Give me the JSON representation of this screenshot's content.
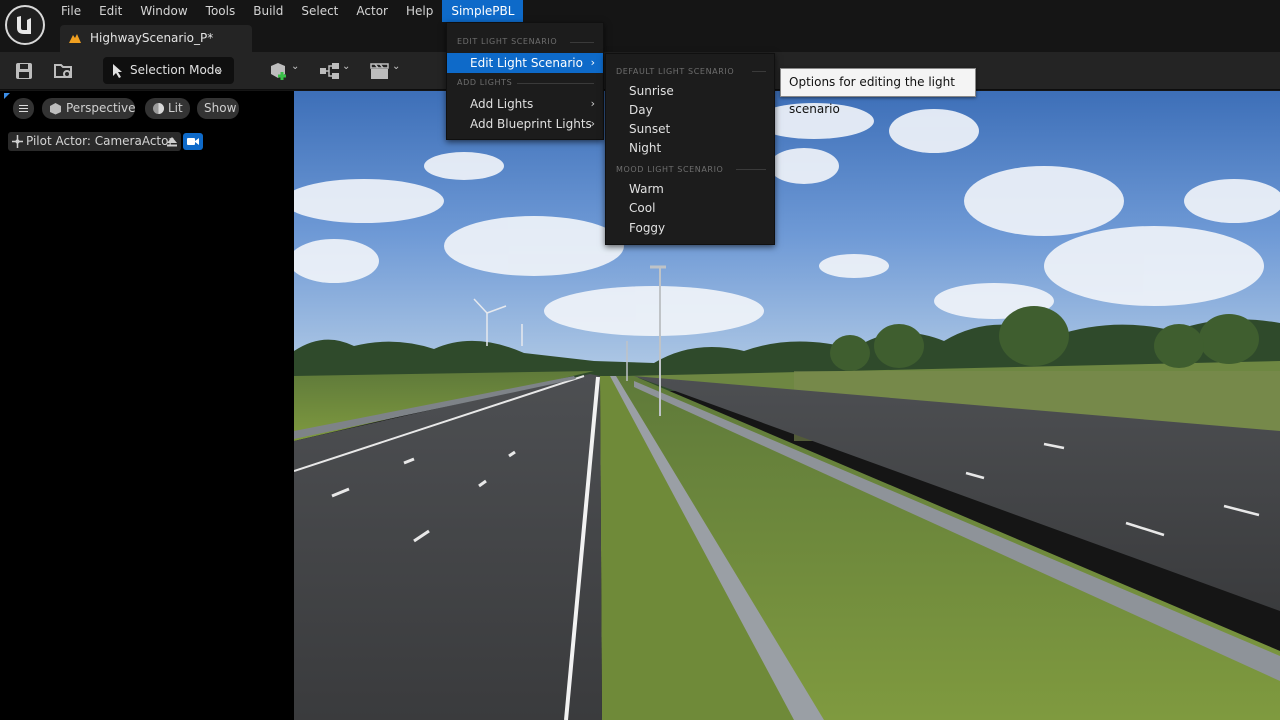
{
  "menubar": {
    "items": [
      "File",
      "Edit",
      "Window",
      "Tools",
      "Build",
      "Select",
      "Actor",
      "Help",
      "SimplePBL"
    ],
    "active_index": 8
  },
  "tab": {
    "title": "HighwayScenario_P*"
  },
  "toolbar": {
    "mode_label": "Selection Mode",
    "icons": [
      "save-icon",
      "content-browser-icon",
      "add-actor-icon",
      "blueprint-icon",
      "cinematics-icon"
    ]
  },
  "viewport": {
    "perspective_label": "Perspective",
    "lit_label": "Lit",
    "show_label": "Show",
    "pilot_label": "Pilot Actor: CameraActor"
  },
  "menu": {
    "header_edit": "EDIT LIGHT SCENARIO",
    "edit_item": "Edit Light Scenario",
    "header_add": "ADD LIGHTS",
    "add_lights": "Add Lights",
    "add_blueprint": "Add Blueprint Lights"
  },
  "submenu": {
    "header_default": "DEFAULT LIGHT SCENARIO",
    "default_items": [
      "Sunrise",
      "Day",
      "Sunset",
      "Night"
    ],
    "header_mood": "MOOD LIGHT SCENARIO",
    "mood_items": [
      "Warm",
      "Cool",
      "Foggy"
    ]
  },
  "tooltip": {
    "text": "Options for editing the light scenario"
  },
  "colors": {
    "accent": "#0e6ac9",
    "background": "#151515",
    "panel": "#242424"
  }
}
